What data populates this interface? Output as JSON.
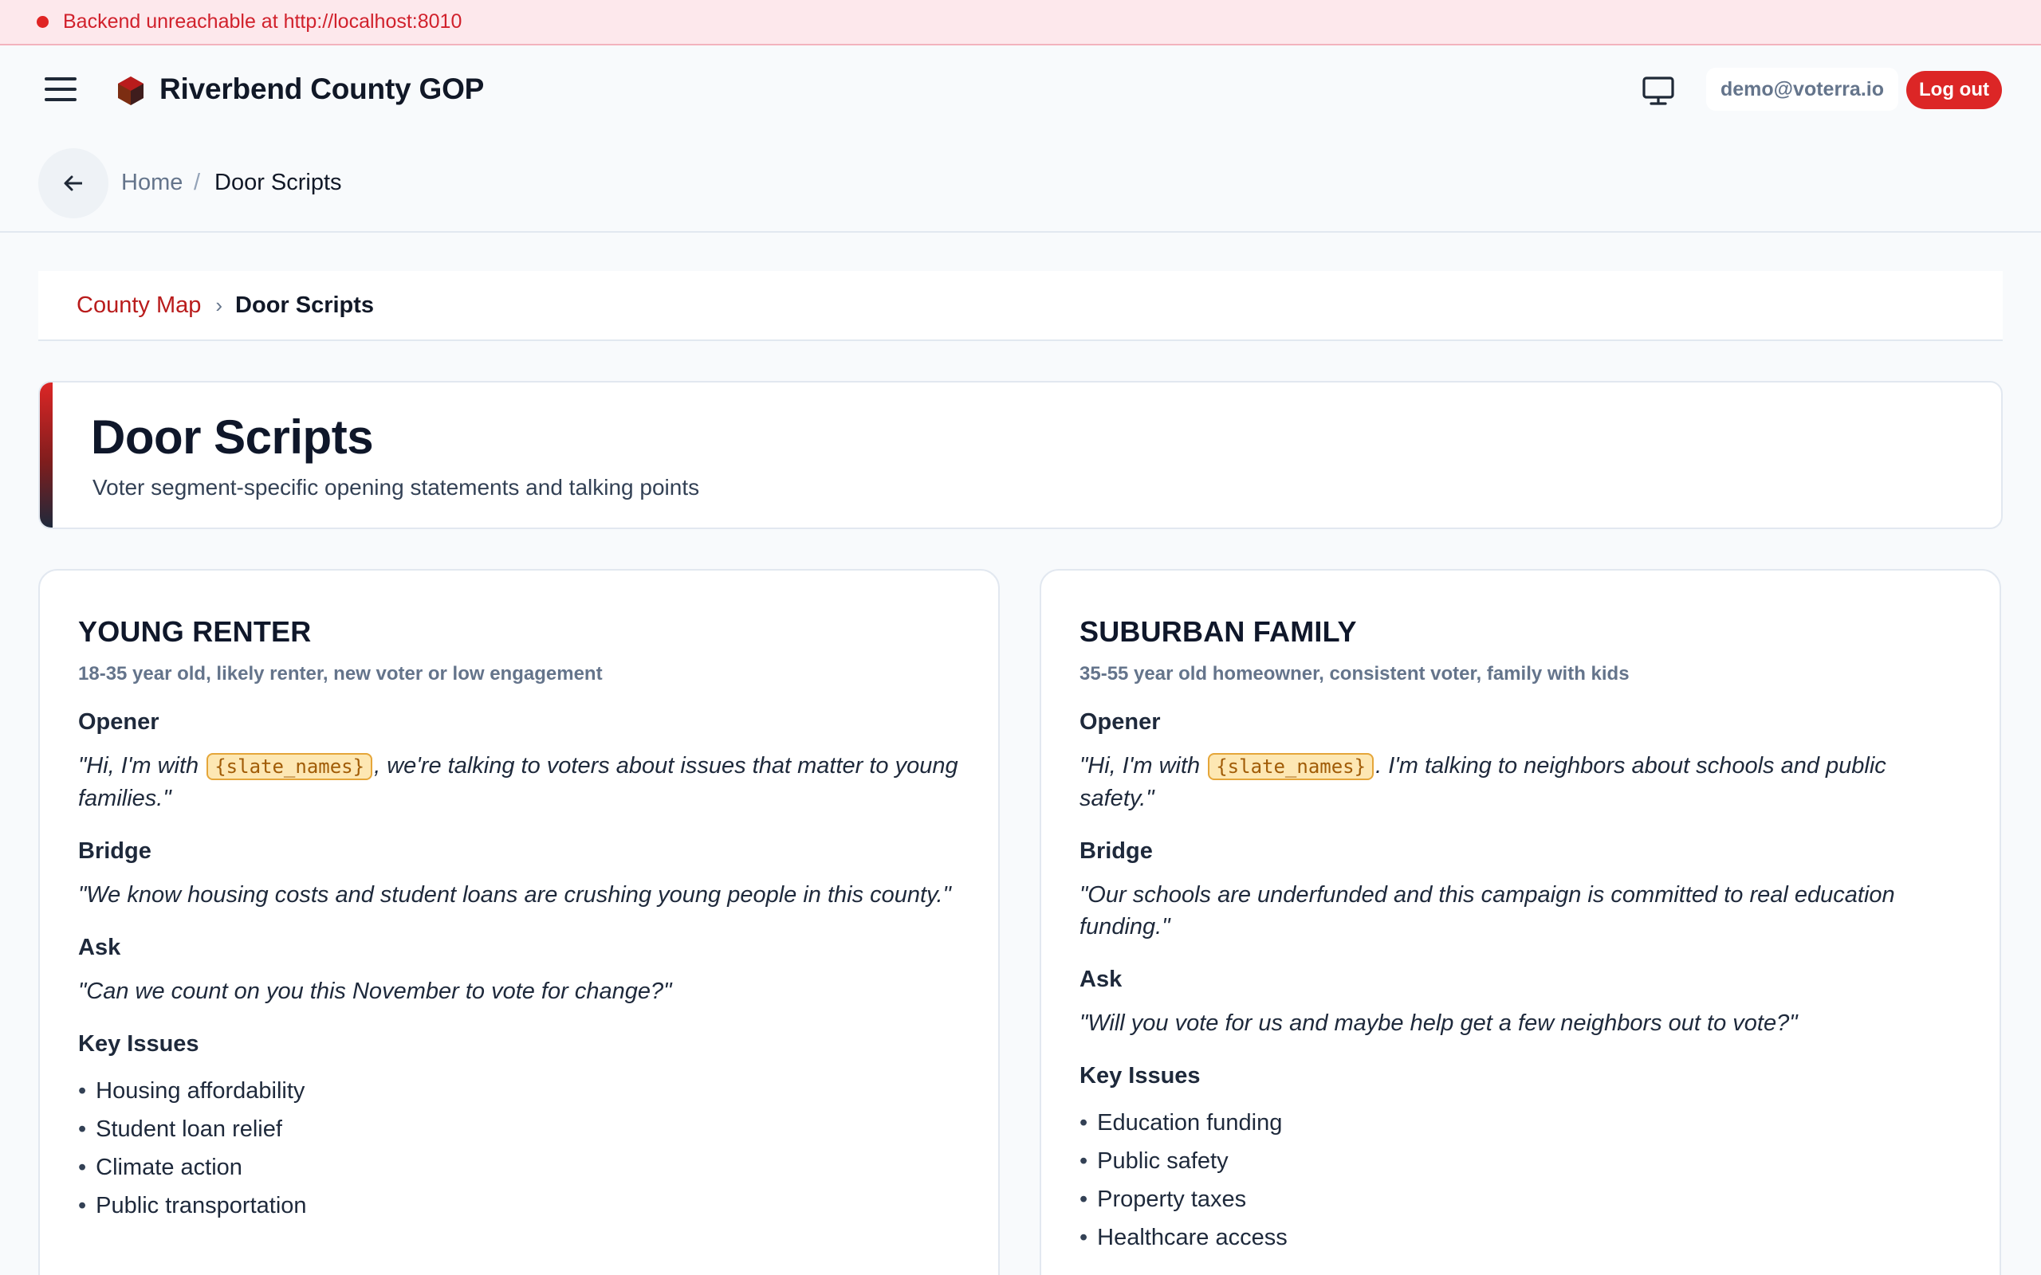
{
  "banner": {
    "message": "Backend unreachable at http://localhost:8010"
  },
  "header": {
    "app_title": "Riverbend County GOP",
    "user_email": "demo@voterra.io",
    "logout_label": "Log out"
  },
  "breadcrumb": {
    "home": "Home",
    "separator": "/",
    "current": "Door Scripts"
  },
  "sub_breadcrumb": {
    "link": "County Map",
    "chevron": "›",
    "current": "Door Scripts"
  },
  "page": {
    "title": "Door Scripts",
    "subtitle": "Voter segment-specific opening statements and talking points"
  },
  "labels": {
    "opener": "Opener",
    "bridge": "Bridge",
    "ask": "Ask",
    "key_issues": "Key Issues"
  },
  "segments": [
    {
      "name": "YOUNG RENTER",
      "description": "18-35 year old, likely renter, new voter or low engagement",
      "opener_pre": "\"Hi, I'm with ",
      "opener_tag": "{slate_names}",
      "opener_post": ", we're talking to voters about issues that matter to young families.\"",
      "bridge": "\"We know housing costs and student loans are crushing young people in this county.\"",
      "ask": "\"Can we count on you this November to vote for change?\"",
      "issues": [
        "Housing affordability",
        "Student loan relief",
        "Climate action",
        "Public transportation"
      ]
    },
    {
      "name": "SUBURBAN FAMILY",
      "description": "35-55 year old homeowner, consistent voter, family with kids",
      "opener_pre": "\"Hi, I'm with ",
      "opener_tag": "{slate_names}",
      "opener_post": ". I'm talking to neighbors about schools and public safety.\"",
      "bridge": "\"Our schools are underfunded and this campaign is committed to real education funding.\"",
      "ask": "\"Will you vote for us and maybe help get a few neighbors out to vote?\"",
      "issues": [
        "Education funding",
        "Public safety",
        "Property taxes",
        "Healthcare access"
      ]
    }
  ],
  "colors": {
    "brand_red": "#dc2626",
    "error_text": "#d1212c",
    "tag_bg": "#fde7b3"
  },
  "icons": [
    "status-dot-icon",
    "hamburger-menu-icon",
    "hexagon-logo-icon",
    "monitor-icon",
    "arrow-left-icon"
  ]
}
